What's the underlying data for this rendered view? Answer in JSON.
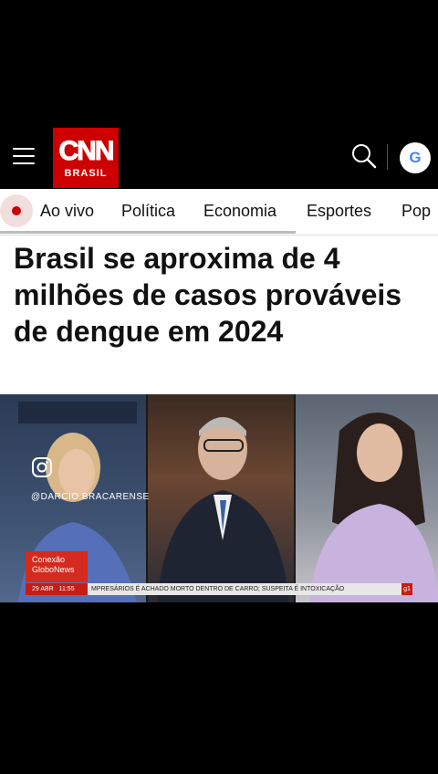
{
  "header": {
    "logo_main": "CNN",
    "logo_sub": "BRASIL",
    "google_label": "G"
  },
  "nav": {
    "items": [
      "Ao vivo",
      "Política",
      "Economia",
      "Esportes",
      "Pop"
    ]
  },
  "article": {
    "headline": "Brasil se aproxima de 4 milhões de casos prováveis de dengue em 2024"
  },
  "video": {
    "instagram_handle": "@DARCIO.BRACARENSE",
    "program_line1": "Conexão",
    "program_line2": "GloboNews",
    "ticker_date": "29 ABR",
    "ticker_time": "11:55",
    "ticker_text": "MPRESÁRIOS É ACHADO MORTO DENTRO DE CARRO; SUSPEITA É INTOXICAÇÃO",
    "ticker_logo": "g1"
  },
  "colors": {
    "brand_red": "#cc0000",
    "live_red": "#cc0000"
  }
}
